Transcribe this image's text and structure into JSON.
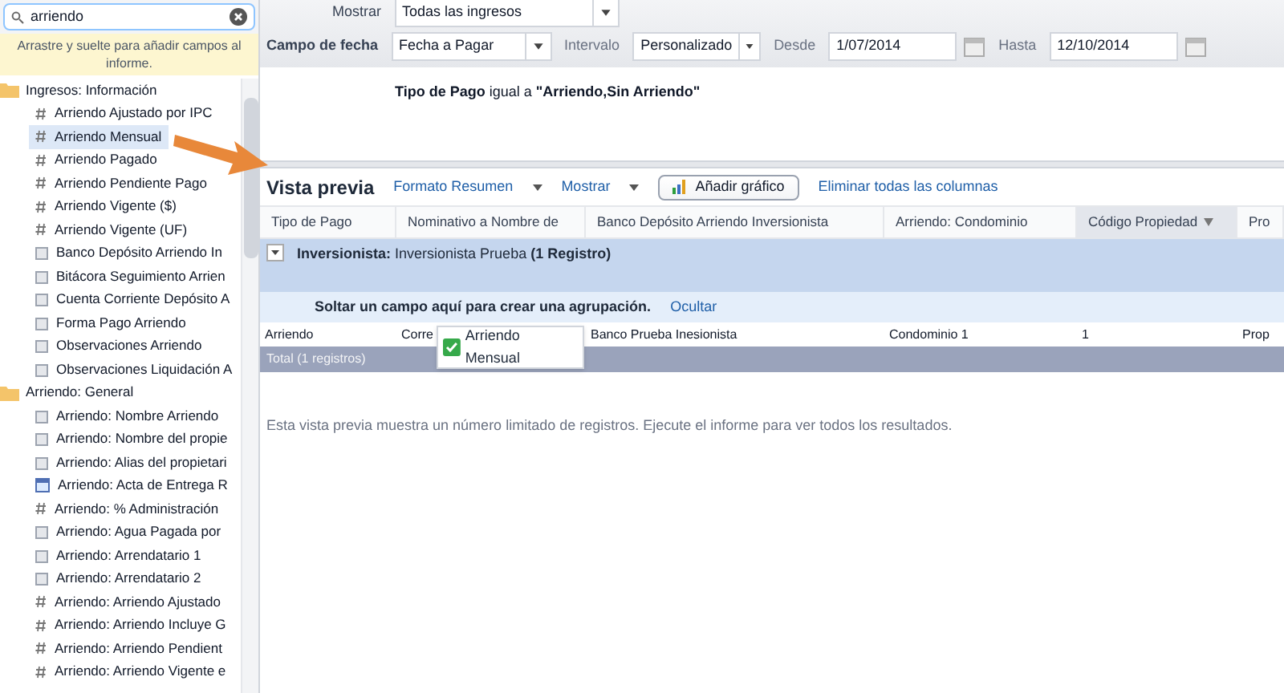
{
  "search": {
    "value": "arriendo"
  },
  "hint": "Arrastre y suelte para añadir campos al informe.",
  "tree": [
    {
      "label": "Ingresos: Información",
      "expanded": true,
      "children": [
        {
          "label": "Arriendo Ajustado por IPC",
          "kind": "number",
          "selected": false
        },
        {
          "label": "Arriendo Mensual",
          "kind": "number",
          "selected": true
        },
        {
          "label": "Arriendo Pagado",
          "kind": "number",
          "selected": false
        },
        {
          "label": "Arriendo Pendiente Pago",
          "kind": "number",
          "selected": false
        },
        {
          "label": "Arriendo Vigente ($)",
          "kind": "number",
          "selected": false
        },
        {
          "label": "Arriendo Vigente (UF)",
          "kind": "number",
          "selected": false
        },
        {
          "label": "Banco Depósito Arriendo In",
          "kind": "text",
          "selected": false
        },
        {
          "label": "Bitácora Seguimiento Arrien",
          "kind": "text",
          "selected": false
        },
        {
          "label": "Cuenta Corriente Depósito A",
          "kind": "text",
          "selected": false
        },
        {
          "label": "Forma Pago Arriendo",
          "kind": "text",
          "selected": false
        },
        {
          "label": "Observaciones Arriendo",
          "kind": "text",
          "selected": false
        },
        {
          "label": "Observaciones Liquidación A",
          "kind": "text",
          "selected": false
        }
      ]
    },
    {
      "label": "Arriendo: General",
      "expanded": true,
      "children": [
        {
          "label": "Arriendo: Nombre Arriendo",
          "kind": "text",
          "selected": false
        },
        {
          "label": "Arriendo: Nombre del propie",
          "kind": "text",
          "selected": false
        },
        {
          "label": "Arriendo: Alias del propietari",
          "kind": "text",
          "selected": false
        },
        {
          "label": "Arriendo: Acta de Entrega R",
          "kind": "date",
          "selected": false
        },
        {
          "label": "Arriendo: % Administración",
          "kind": "number",
          "selected": false
        },
        {
          "label": "Arriendo: Agua Pagada por",
          "kind": "text",
          "selected": false
        },
        {
          "label": "Arriendo: Arrendatario 1",
          "kind": "text",
          "selected": false
        },
        {
          "label": "Arriendo: Arrendatario 2",
          "kind": "text",
          "selected": false
        },
        {
          "label": "Arriendo: Arriendo Ajustado",
          "kind": "number",
          "selected": false
        },
        {
          "label": "Arriendo: Arriendo Incluye G",
          "kind": "number",
          "selected": false
        },
        {
          "label": "Arriendo: Arriendo Pendient",
          "kind": "number",
          "selected": false
        },
        {
          "label": "Arriendo: Arriendo Vigente e",
          "kind": "number",
          "selected": false
        }
      ]
    }
  ],
  "filters": {
    "show_label": "Mostrar",
    "show_value": "Todas las ingresos",
    "date_field_label": "Campo de fecha",
    "date_field_value": "Fecha a Pagar",
    "interval_label": "Intervalo",
    "interval_value": "Personalizado",
    "from_label": "Desde",
    "from_value": "1/07/2014",
    "to_label": "Hasta",
    "to_value": "12/10/2014",
    "condition": "**Tipo de Pago** igual a **\"Arriendo,Sin Arriendo\"**"
  },
  "preview": {
    "title": "Vista previa",
    "format": "Formato Resumen",
    "show": "Mostrar",
    "add_chart": "Añadir gráfico",
    "remove_columns": "Eliminar todas las columnas"
  },
  "table": {
    "columns": [
      {
        "label": "Tipo de Pago",
        "sorted": false
      },
      {
        "label": "Nominativo a Nombre de",
        "sorted": false
      },
      {
        "label": "Banco Depósito Arriendo Inversionista",
        "sorted": false
      },
      {
        "label": "Arriendo: Condominio",
        "sorted": false
      },
      {
        "label": "Código Propiedad",
        "sorted": true
      },
      {
        "label": "Pro",
        "sorted": false
      }
    ],
    "group": "**Inversionista:** Inversionista Prueba **(1 Registro)**",
    "drop_hint": "Soltar un campo aquí para crear una agrupación.",
    "hide": "Ocultar",
    "rows": [
      [
        "Arriendo",
        "Corre",
        "Banco Prueba Inesionista",
        "Condominio 1",
        "1",
        "Prop"
      ]
    ],
    "total": "Total (1 registros)"
  },
  "drag_item": "Arriendo Mensual",
  "message": "Esta vista previa muestra un número limitado de registros. Ejecute el informe para ver todos los resultados."
}
